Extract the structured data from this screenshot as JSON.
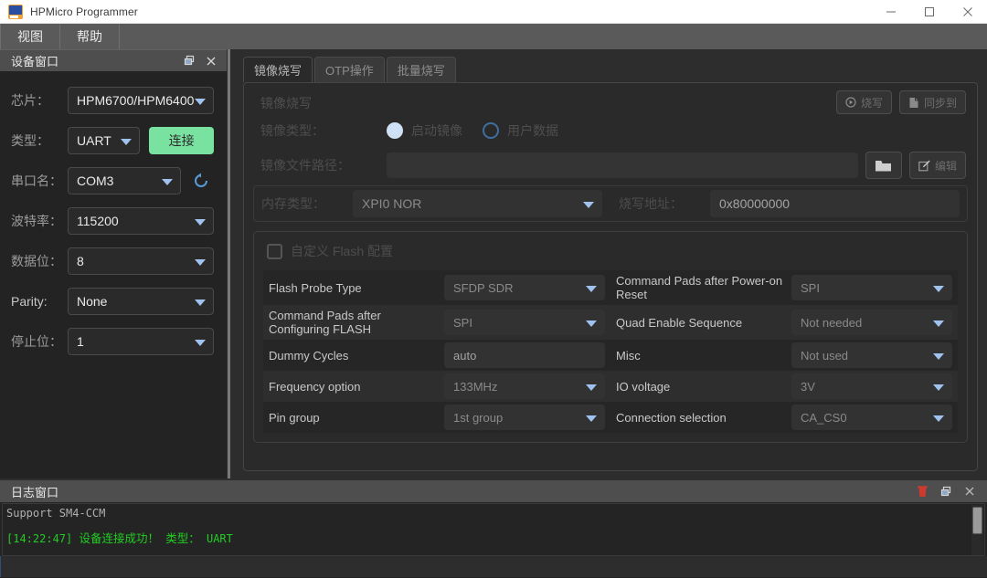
{
  "window": {
    "title": "HPMicro Programmer",
    "icon": "app-icon",
    "minimize": "minimize-icon",
    "maximize": "maximize-icon",
    "close": "close-icon"
  },
  "menubar": {
    "items": [
      {
        "label": "视图"
      },
      {
        "label": "帮助"
      }
    ]
  },
  "device_dock": {
    "title": "设备窗口",
    "float_icon": "float-icon",
    "close_icon": "close-icon",
    "fields": {
      "chip": {
        "label": "芯片：",
        "value": "HPM6700/HPM6400"
      },
      "type": {
        "label": "类型：",
        "value": "UART"
      },
      "connect_button": "连接",
      "port": {
        "label": "串口名：",
        "value": "COM3"
      },
      "refresh_icon": "refresh-icon",
      "baud": {
        "label": "波特率：",
        "value": "115200"
      },
      "databits": {
        "label": "数据位：",
        "value": "8"
      },
      "parity": {
        "label": "Parity:",
        "value": "None"
      },
      "stopbits": {
        "label": "停止位：",
        "value": "1"
      }
    }
  },
  "main": {
    "tabs": [
      {
        "label": "镜像烧写",
        "active": true
      },
      {
        "label": "OTP操作",
        "active": false
      },
      {
        "label": "批量烧写",
        "active": false
      }
    ],
    "panel_title": "镜像烧写",
    "actions": [
      {
        "label": "烧写",
        "icon": "play-circle-icon"
      },
      {
        "label": "同步到",
        "icon": "file-icon"
      }
    ],
    "image_type": {
      "label": "镜像类型：",
      "options": [
        {
          "label": "启动镜像",
          "selected": true
        },
        {
          "label": "用户数据",
          "selected": false
        }
      ]
    },
    "file_path": {
      "label": "镜像文件路径：",
      "value": "",
      "browse_icon": "folder-icon",
      "edit_button": {
        "label": "编辑",
        "icon": "pencil-icon"
      }
    },
    "memory_type": {
      "label": "内存类型：",
      "value": "XPI0 NOR"
    },
    "flash_address": {
      "label": "烧写地址：",
      "value": "0x80000000"
    },
    "flash_config": {
      "checkbox_label": "自定义 Flash 配置",
      "checked": false,
      "rows": [
        {
          "left": {
            "label": "Flash Probe Type",
            "value": "SFDP SDR",
            "control": "select"
          },
          "right": {
            "label": "Command Pads after Power-on Reset",
            "value": "SPI",
            "control": "select"
          }
        },
        {
          "left": {
            "label": "Command Pads after Configuring FLASH",
            "value": "SPI",
            "control": "select"
          },
          "right": {
            "label": "Quad Enable Sequence",
            "value": "Not needed",
            "control": "select"
          }
        },
        {
          "left": {
            "label": "Dummy Cycles",
            "value": "auto",
            "control": "input"
          },
          "right": {
            "label": "Misc",
            "value": "Not used",
            "control": "select"
          }
        },
        {
          "left": {
            "label": "Frequency option",
            "value": "133MHz",
            "control": "select"
          },
          "right": {
            "label": "IO voltage",
            "value": "3V",
            "control": "select"
          }
        },
        {
          "left": {
            "label": "Pin group",
            "value": "1st group",
            "control": "select"
          },
          "right": {
            "label": "Connection selection",
            "value": "CA_CS0",
            "control": "select"
          }
        }
      ]
    }
  },
  "log_dock": {
    "title": "日志窗口",
    "clear_icon": "trash-icon",
    "float_icon": "float-icon",
    "close_icon": "close-icon",
    "lines": [
      {
        "text": "Support SM4-CCM",
        "color": "#b0b0b0"
      },
      {
        "time": "[14:22:47]",
        "message": "设备连接成功！",
        "field": "类型：",
        "value": "UART",
        "color": "#22cc22"
      }
    ]
  },
  "colors": {
    "accent_green": "#7ae2a0",
    "log_green": "#22cc22",
    "radio_blue": "#cfe2f5",
    "arrow_blue": "#9fc3ee",
    "trash_red": "#cf3a30"
  }
}
